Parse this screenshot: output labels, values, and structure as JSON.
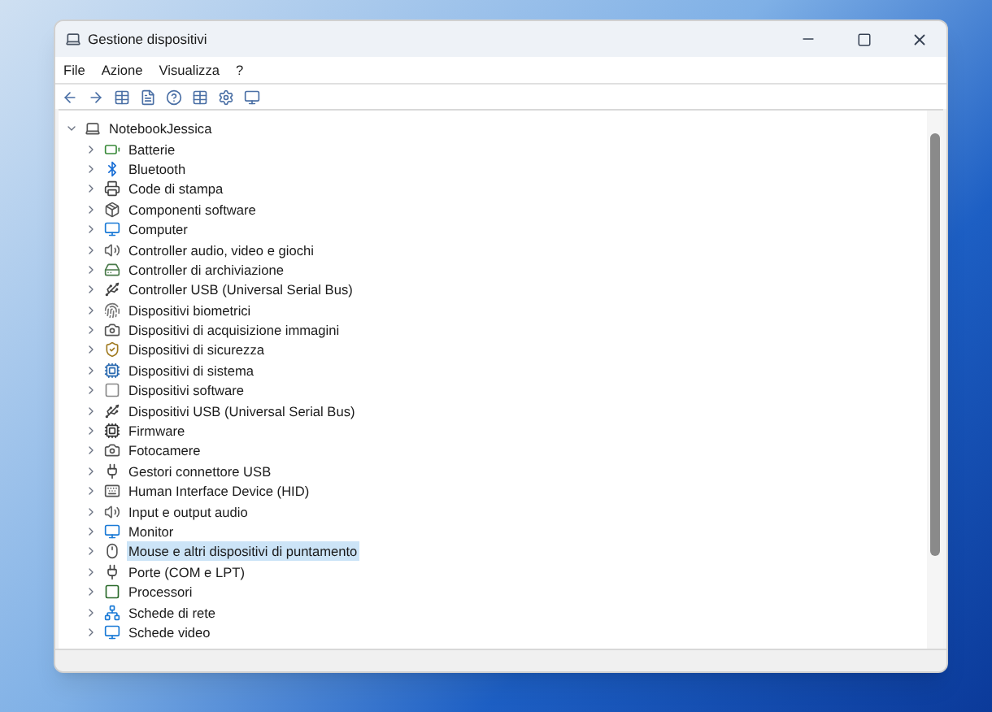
{
  "window": {
    "title": "Gestione dispositivi"
  },
  "menu": [
    "File",
    "Azione",
    "Visualizza",
    "?"
  ],
  "tree": {
    "label": "NotebookJessica",
    "expanded": true,
    "children": [
      {
        "label": "Batterie",
        "expanded": false,
        "selected": false
      },
      {
        "label": "Bluetooth",
        "expanded": false,
        "selected": false
      },
      {
        "label": "Code di stampa",
        "expanded": false,
        "selected": false
      },
      {
        "label": "Componenti software",
        "expanded": false,
        "selected": false
      },
      {
        "label": "Computer",
        "expanded": false,
        "selected": false
      },
      {
        "label": "Controller audio, video e giochi",
        "expanded": false,
        "selected": false
      },
      {
        "label": "Controller di archiviazione",
        "expanded": false,
        "selected": false
      },
      {
        "label": "Controller USB (Universal Serial Bus)",
        "expanded": false,
        "selected": false
      },
      {
        "label": "Dispositivi biometrici",
        "expanded": false,
        "selected": false
      },
      {
        "label": "Dispositivi di acquisizione immagini",
        "expanded": false,
        "selected": false
      },
      {
        "label": "Dispositivi di sicurezza",
        "expanded": false,
        "selected": false
      },
      {
        "label": "Dispositivi di sistema",
        "expanded": false,
        "selected": false
      },
      {
        "label": "Dispositivi software",
        "expanded": false,
        "selected": false
      },
      {
        "label": "Dispositivi USB (Universal Serial Bus)",
        "expanded": false,
        "selected": false
      },
      {
        "label": "Firmware",
        "expanded": false,
        "selected": false
      },
      {
        "label": "Fotocamere",
        "expanded": false,
        "selected": false
      },
      {
        "label": "Gestori connettore USB",
        "expanded": false,
        "selected": false
      },
      {
        "label": "Human Interface Device (HID)",
        "expanded": false,
        "selected": false
      },
      {
        "label": "Input e output audio",
        "expanded": false,
        "selected": false
      },
      {
        "label": "Monitor",
        "expanded": false,
        "selected": false
      },
      {
        "label": "Mouse e altri dispositivi di puntamento",
        "expanded": false,
        "selected": true
      },
      {
        "label": "Porte (COM e LPT)",
        "expanded": false,
        "selected": false
      },
      {
        "label": "Processori",
        "expanded": false,
        "selected": false
      },
      {
        "label": "Schede di rete",
        "expanded": false,
        "selected": false
      },
      {
        "label": "Schede video",
        "expanded": false,
        "selected": false
      }
    ]
  }
}
